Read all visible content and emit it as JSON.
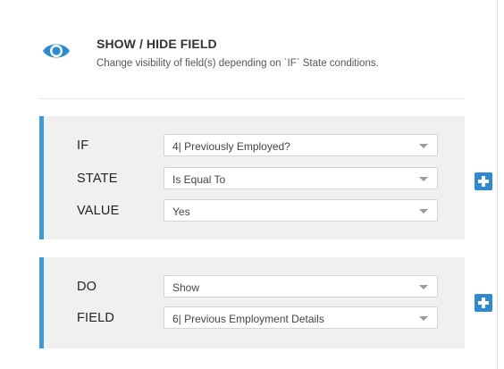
{
  "header": {
    "icon": "eye-icon",
    "title": "SHOW / HIDE FIELD",
    "subtitle": "Change visibility of field(s) depending on `IF` State conditions."
  },
  "condition_section": {
    "rows": [
      {
        "label": "IF",
        "value": "4| Previously Employed?"
      },
      {
        "label": "STATE",
        "value": "Is Equal To"
      },
      {
        "label": "VALUE",
        "value": "Yes"
      }
    ],
    "add_icon": "plus-icon"
  },
  "action_section": {
    "rows": [
      {
        "label": "DO",
        "value": "Show"
      },
      {
        "label": "FIELD",
        "value": "6| Previous Employment Details"
      }
    ],
    "add_icon": "plus-icon"
  },
  "colors": {
    "accent": "#3e9ad9",
    "button": "#2d8ad6",
    "section_bg": "#f0f0ef"
  }
}
